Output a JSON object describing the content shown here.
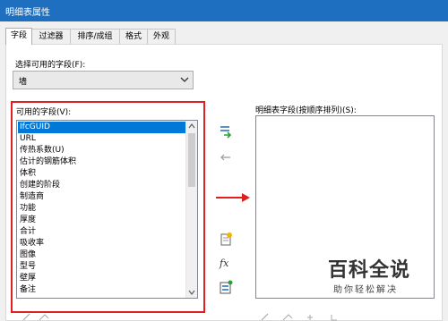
{
  "window": {
    "title": "明细表属性"
  },
  "tabs": [
    {
      "label": "字段",
      "active": true
    },
    {
      "label": "过滤器",
      "active": false
    },
    {
      "label": "排序/成组",
      "active": false
    },
    {
      "label": "格式",
      "active": false
    },
    {
      "label": "外观",
      "active": false
    }
  ],
  "field_select": {
    "label": "选择可用的字段(F):",
    "value": "墙"
  },
  "available": {
    "label": "可用的字段(V):",
    "items": [
      "IfcGUID",
      "URL",
      "传热系数(U)",
      "估计的钢筋体积",
      "体积",
      "创建的阶段",
      "制造商",
      "功能",
      "厚度",
      "合计",
      "吸收率",
      "图像",
      "型号",
      "壁厚",
      "备注"
    ],
    "selected_index": 0
  },
  "scheduled": {
    "label": "明细表字段(按顺序排列)(S):"
  },
  "buttons": {
    "add_icon": "add-field-icon",
    "remove_icon": "remove-field-arrow-icon",
    "param_icon": "new-parameter-icon",
    "formula_icon": "formula-icon",
    "formula_glyph": "fx",
    "combine_icon": "combine-parameters-icon"
  },
  "watermark": {
    "title": "百科全说",
    "subtitle": "助你轻松解决"
  },
  "colors": {
    "titlebar": "#1e6fbf",
    "selection": "#0078d7",
    "highlight_box": "#e02020"
  }
}
